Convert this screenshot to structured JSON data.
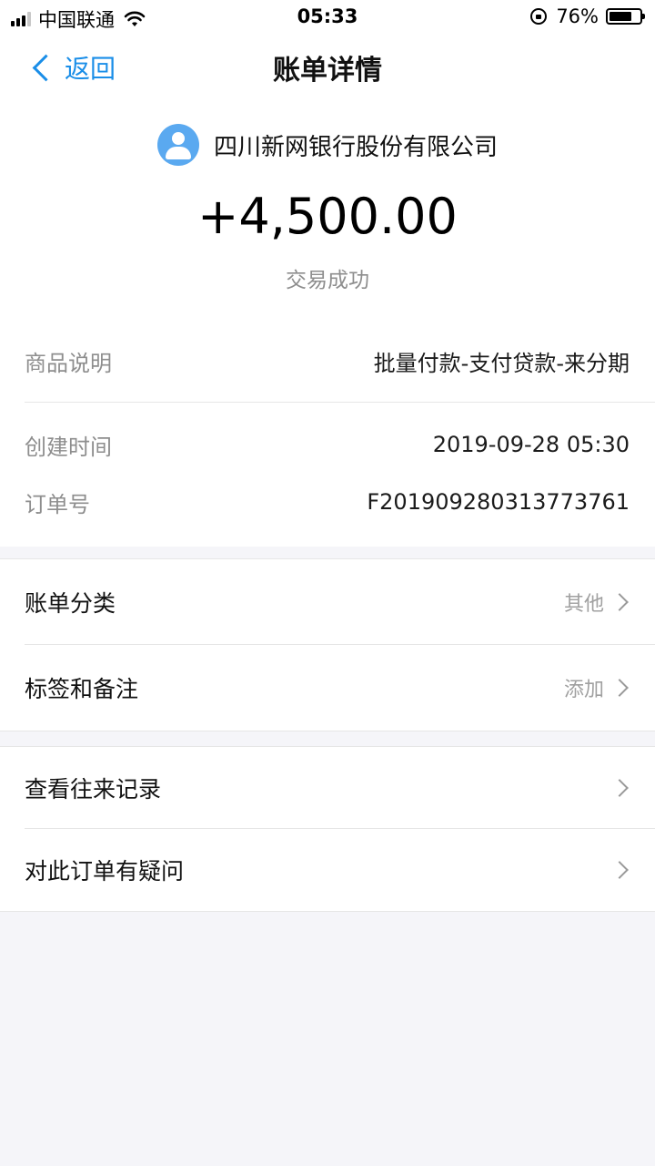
{
  "status_bar": {
    "carrier": "中国联通",
    "time": "05:33",
    "battery": "76%",
    "battery_level": 0.76
  },
  "nav": {
    "back_label": "返回",
    "title": "账单详情"
  },
  "merchant": {
    "name": "四川新网银行股份有限公司"
  },
  "transaction": {
    "amount": "+4,500.00",
    "status": "交易成功"
  },
  "details": {
    "product_label": "商品说明",
    "product_value": "批量付款-支付贷款-来分期",
    "created_label": "创建时间",
    "created_value": "2019-09-28 05:30",
    "order_label": "订单号",
    "order_value": "F20190928031377376​1"
  },
  "actions": {
    "category_label": "账单分类",
    "category_value": "其他",
    "tags_label": "标签和备注",
    "tags_value": "添加",
    "history_label": "查看往来记录",
    "question_label": "对此订单有疑问"
  },
  "icons": {
    "back": "chevron-left-icon",
    "avatar": "user-avatar-icon",
    "row_arrow": "chevron-right-icon"
  },
  "colors": {
    "accent": "#1a8ee8",
    "avatar": "#5aa9f0",
    "background": "#f5f5f9"
  }
}
